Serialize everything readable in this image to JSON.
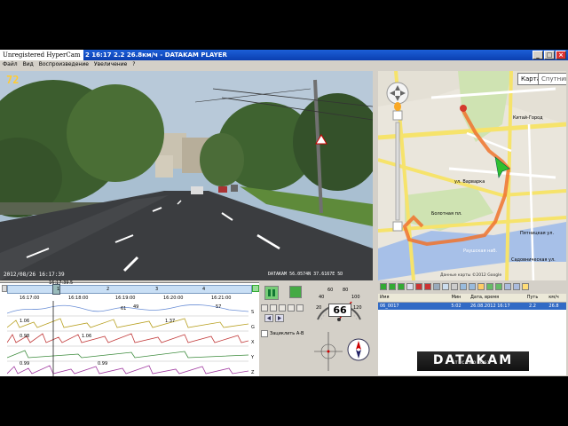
{
  "window": {
    "watermark": "Unregistered HyperCam",
    "title": "2 16:17    2.2    26.8км/ч - DATAKAM PLAYER"
  },
  "menu": [
    "Файл",
    "Вид",
    "Воспроизведение",
    "Увеличение",
    "?"
  ],
  "video": {
    "speed_overlay": "72",
    "datetime_overlay": "2012/08/26  16:17:39",
    "gps_overlay": "DATAKAM 56.0574N 37.6167E 5D"
  },
  "map": {
    "tab_map": "Карта",
    "tab_satellite": "Спутник",
    "labels": [
      "ул. Варварка",
      "Китай-Город",
      "Болотная пл.",
      "Раушская наб.",
      "Садовническая ул.",
      "Пятницкая ул."
    ],
    "copyright": "Данные карты ©2012 Google"
  },
  "tracklist": {
    "headers": [
      "Имя",
      "Мин",
      "Дата, время",
      "Путь",
      "км/ч"
    ],
    "rows": [
      {
        "name": "06_0017",
        "min": "5:02",
        "datetime": "26.08.2012 16:17",
        "path": "2.2",
        "speed": "26.8"
      }
    ]
  },
  "logo": {
    "text": "DATAKAM",
    "subtitle": "TECHNOLOGY"
  },
  "timeline": {
    "current_label": "16:17:39.5",
    "ticks": [
      "16:17:00",
      "16:18:00",
      "16:19:00",
      "16:20:00",
      "16:21:00"
    ],
    "minutes": [
      "1",
      "2",
      "3",
      "4"
    ],
    "channels": [
      "S",
      "G",
      "X",
      "Y",
      "Z"
    ],
    "value_labels": [
      "61",
      "49",
      "57",
      "1.37",
      "1.06",
      "0.98",
      "1.06",
      "0.99",
      "0.99"
    ]
  },
  "controls": {
    "speed_value": "66",
    "loop_label": "Зациклить А-В",
    "gauge_ticks": [
      "20",
      "40",
      "60",
      "80",
      "100",
      "120"
    ]
  }
}
